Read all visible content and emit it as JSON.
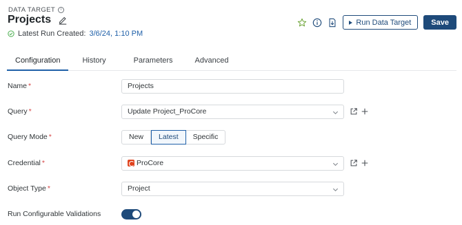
{
  "header": {
    "eyebrow": "DATA TARGET",
    "title": "Projects",
    "latest_run_label": "Latest Run Created:",
    "latest_run_value": "3/6/24, 1:10 PM"
  },
  "actions": {
    "run_label": "Run Data Target",
    "save_label": "Save"
  },
  "tabs": [
    {
      "label": "Configuration",
      "active": true
    },
    {
      "label": "History",
      "active": false
    },
    {
      "label": "Parameters",
      "active": false
    },
    {
      "label": "Advanced",
      "active": false
    }
  ],
  "form": {
    "name": {
      "label": "Name",
      "required": "*",
      "value": "Projects"
    },
    "query": {
      "label": "Query",
      "required": "*",
      "value": "Update Project_ProCore"
    },
    "query_mode": {
      "label": "Query Mode",
      "required": "*",
      "options": [
        "New",
        "Latest",
        "Specific"
      ],
      "selected": "Latest"
    },
    "credential": {
      "label": "Credential",
      "required": "*",
      "value": "ProCore"
    },
    "object_type": {
      "label": "Object Type",
      "required": "*",
      "value": "Project"
    },
    "validations": {
      "label": "Run Configurable Validations",
      "enabled": true
    }
  },
  "colors": {
    "primary": "#1e4a7a",
    "link": "#1e5fa8",
    "required": "#d64545",
    "success": "#4caf50",
    "star": "#6fa53a"
  }
}
